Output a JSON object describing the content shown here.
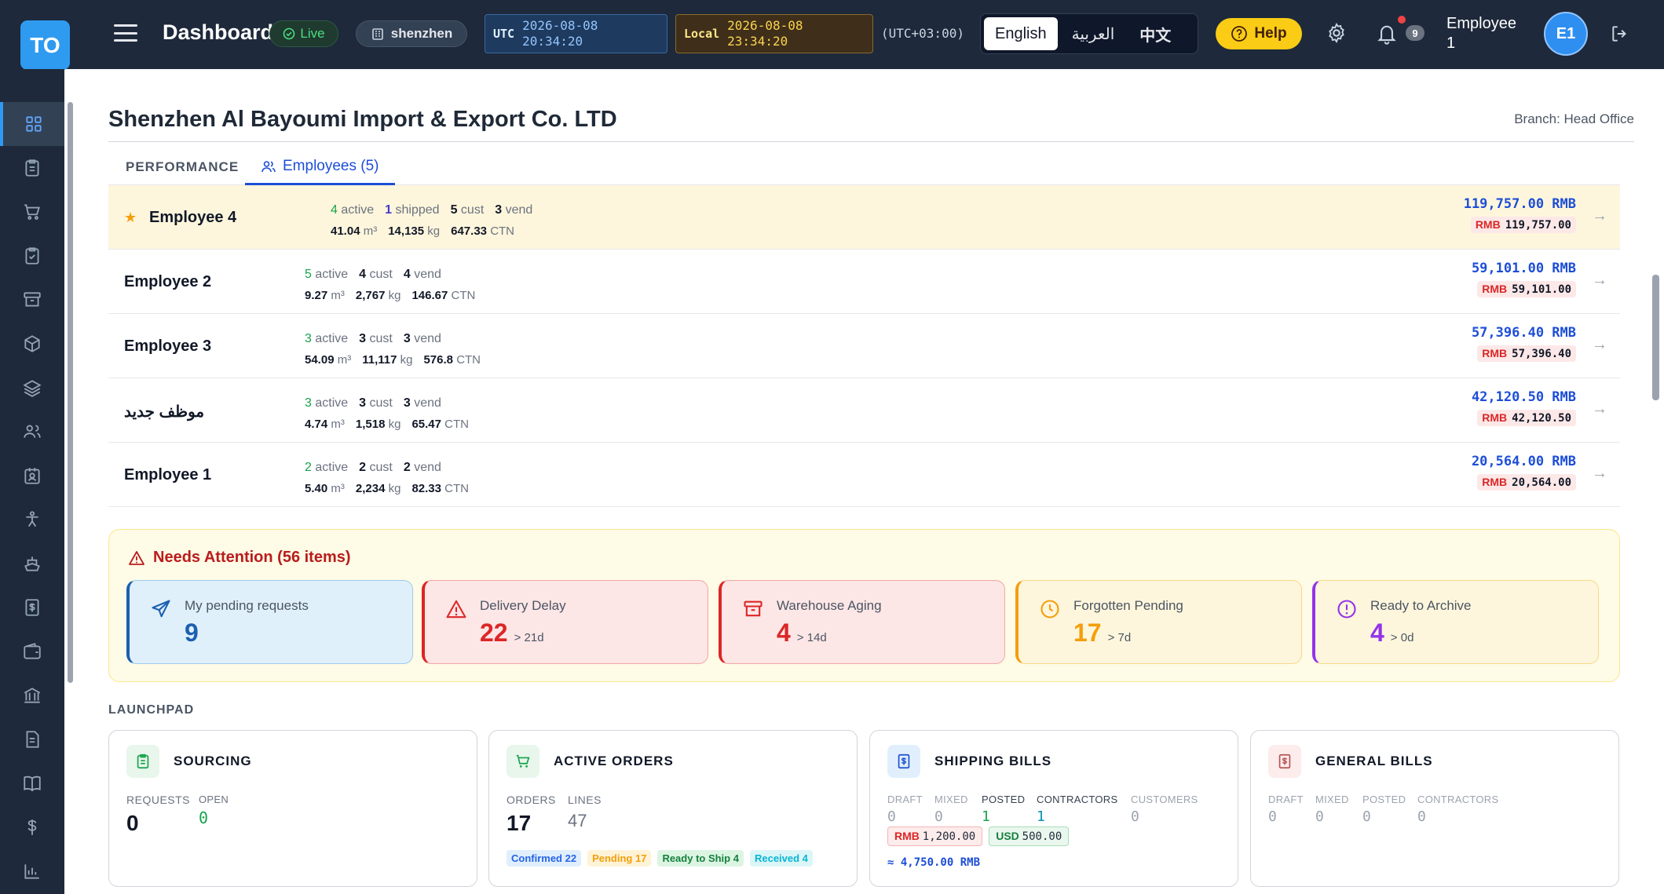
{
  "app": {
    "logo": "TO",
    "title": "Dashboard",
    "live_label": "Live",
    "branch_chip": "shenzhen"
  },
  "clock": {
    "utc_label": "UTC",
    "utc_date": "2026-08-08",
    "utc_time": "20:34:20",
    "local_label": "Local",
    "local_date": "2026-08-08",
    "local_time": "23:34:20",
    "tz": "(UTC+03:00)"
  },
  "languages": [
    "English",
    "العربية",
    "中文"
  ],
  "header": {
    "help": "Help",
    "notifications": "9",
    "user_line1": "Employee",
    "user_line2": "1",
    "avatar": "E1"
  },
  "sidebar_icons": [
    "dashboard-icon",
    "clipboard-icon",
    "cart-icon",
    "checklist-icon",
    "archive-icon",
    "box-icon",
    "layers-icon",
    "users-icon",
    "badge-icon",
    "person-icon",
    "ship-icon",
    "bill-icon",
    "wallet-icon",
    "bank-icon",
    "document-icon",
    "book-icon",
    "dollar-icon",
    "chart-icon"
  ],
  "page": {
    "company": "Shenzhen Al Bayoumi Import & Export Co. LTD",
    "branch": "Branch: Head Office"
  },
  "tabs": {
    "performance": "PERFORMANCE",
    "employees": "Employees (5)"
  },
  "employees": [
    {
      "name": "Employee 4",
      "star": true,
      "active": "4",
      "shipped": "1",
      "cust": "5",
      "vend": "3",
      "cbm": "41.04",
      "kg": "14,135",
      "ctn": "647.33",
      "amount": "119,757.00 RMB",
      "amount_rmb": "119,757.00"
    },
    {
      "name": "Employee 2",
      "star": false,
      "active": "5",
      "shipped": "",
      "cust": "4",
      "vend": "4",
      "cbm": "9.27",
      "kg": "2,767",
      "ctn": "146.67",
      "amount": "59,101.00 RMB",
      "amount_rmb": "59,101.00"
    },
    {
      "name": "Employee 3",
      "star": false,
      "active": "3",
      "shipped": "",
      "cust": "3",
      "vend": "3",
      "cbm": "54.09",
      "kg": "11,117",
      "ctn": "576.8",
      "amount": "57,396.40 RMB",
      "amount_rmb": "57,396.40"
    },
    {
      "name": "موظف جديد",
      "star": false,
      "active": "3",
      "shipped": "",
      "cust": "3",
      "vend": "3",
      "cbm": "4.74",
      "kg": "1,518",
      "ctn": "65.47",
      "amount": "42,120.50 RMB",
      "amount_rmb": "42,120.50"
    },
    {
      "name": "Employee 1",
      "star": false,
      "active": "2",
      "shipped": "",
      "cust": "2",
      "vend": "2",
      "cbm": "5.40",
      "kg": "2,234",
      "ctn": "82.33",
      "amount": "20,564.00 RMB",
      "amount_rmb": "20,564.00"
    }
  ],
  "stat_labels": {
    "active": "active",
    "shipped": "shipped",
    "cust": "cust",
    "vend": "vend",
    "cbm_unit": "m³",
    "kg_unit": "kg",
    "ctn_unit": "CTN",
    "rmb": "RMB"
  },
  "attention": {
    "title": "Needs Attention (56 items)",
    "cards": [
      {
        "label": "My pending requests",
        "value": "9",
        "suffix": ""
      },
      {
        "label": "Delivery Delay",
        "value": "22",
        "suffix": "> 21d"
      },
      {
        "label": "Warehouse Aging",
        "value": "4",
        "suffix": "> 14d"
      },
      {
        "label": "Forgotten Pending",
        "value": "17",
        "suffix": "> 7d"
      },
      {
        "label": "Ready to Archive",
        "value": "4",
        "suffix": "> 0d"
      }
    ]
  },
  "launchpad": {
    "title": "LAUNCHPAD",
    "sourcing": {
      "title": "SOURCING",
      "requests_label": "REQUESTS",
      "requests": "0",
      "open_label": "OPEN",
      "open": "0"
    },
    "orders": {
      "title": "ACTIVE ORDERS",
      "orders_label": "ORDERS",
      "orders": "17",
      "lines_label": "LINES",
      "lines": "47",
      "pills": [
        "Confirmed 22",
        "Pending 17",
        "Ready to Ship 4",
        "Received 4"
      ]
    },
    "shipping": {
      "title": "SHIPPING BILLS",
      "cols": [
        {
          "k": "DRAFT",
          "v": "0"
        },
        {
          "k": "MIXED",
          "v": "0"
        },
        {
          "k": "POSTED",
          "v": "1"
        },
        {
          "k": "CONTRACTORS",
          "v": "1"
        },
        {
          "k": "CUSTOMERS",
          "v": "0"
        }
      ],
      "rmb_label": "RMB",
      "rmb": "1,200.00",
      "usd_label": "USD",
      "usd": "500.00",
      "total": "≈ 4,750.00 RMB"
    },
    "general": {
      "title": "GENERAL BILLS",
      "cols": [
        {
          "k": "DRAFT",
          "v": "0"
        },
        {
          "k": "MIXED",
          "v": "0"
        },
        {
          "k": "POSTED",
          "v": "0"
        },
        {
          "k": "CONTRACTORS",
          "v": "0"
        }
      ]
    }
  }
}
